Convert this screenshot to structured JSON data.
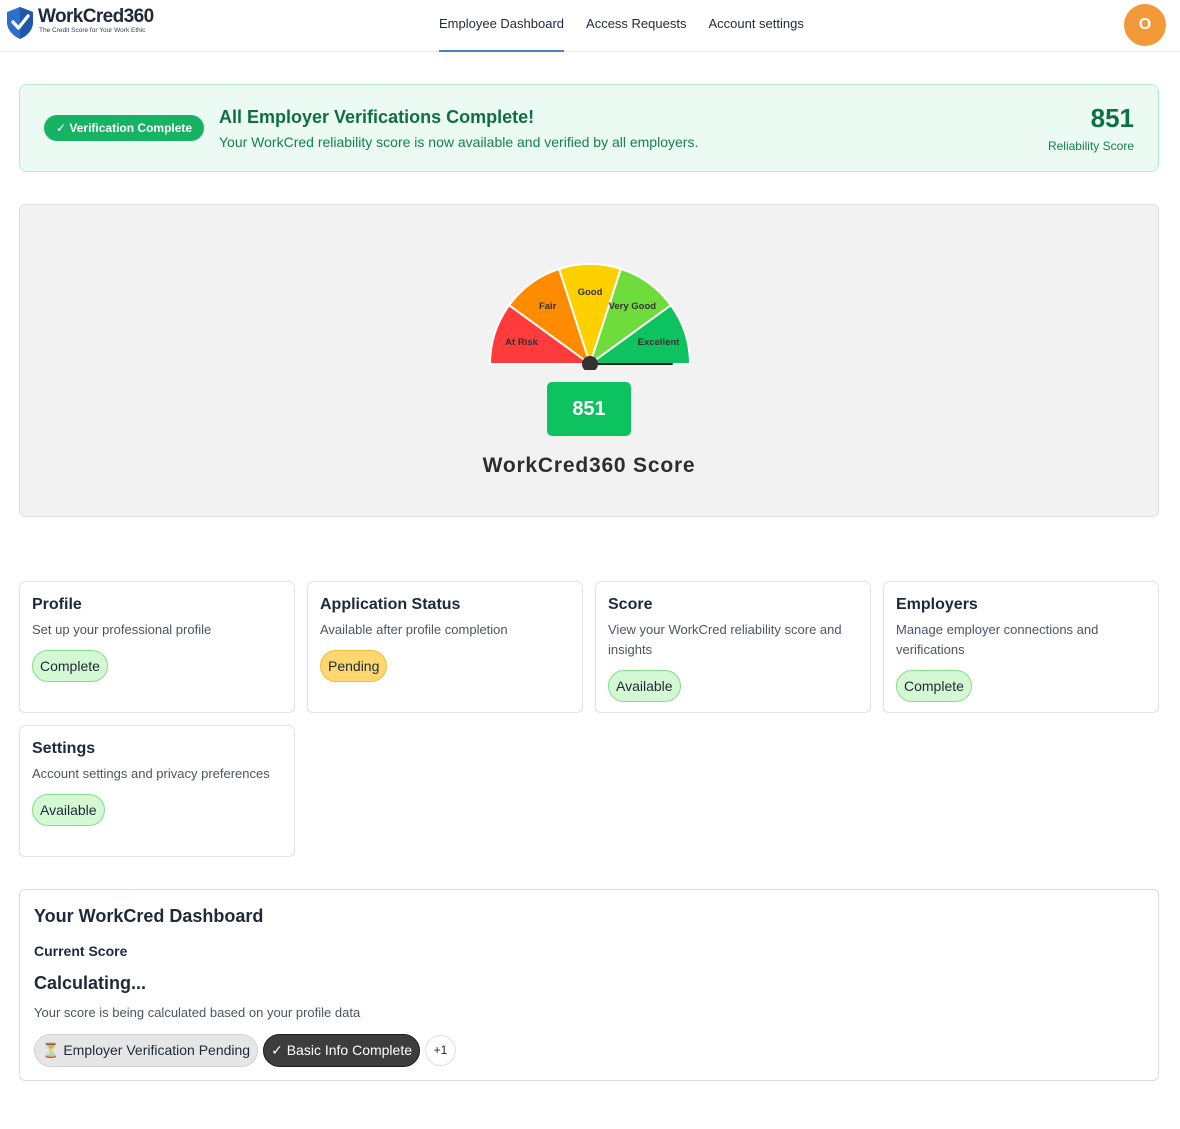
{
  "header": {
    "app_name": "WorkCred360",
    "tagline": "The Credit Score for Your Work Ethic",
    "nav": [
      {
        "label": "Employee Dashboard",
        "active": true
      },
      {
        "label": "Access Requests",
        "active": false
      },
      {
        "label": "Account settings",
        "active": false
      }
    ],
    "avatar_initial": "O"
  },
  "banner": {
    "badge": "✓ Verification Complete",
    "title": "All Employer Verifications Complete!",
    "subtitle": "Your WorkCred reliability score is now available and verified by all employers.",
    "score": "851",
    "score_label": "Reliability Score"
  },
  "gauge": {
    "segments": [
      {
        "label": "At Risk",
        "color": "#ff3b3b"
      },
      {
        "label": "Fair",
        "color": "#ff8c00"
      },
      {
        "label": "Good",
        "color": "#ffd000"
      },
      {
        "label": "Very Good",
        "color": "#6edc3a"
      },
      {
        "label": "Excellent",
        "color": "#0cc35f"
      }
    ],
    "score": "851",
    "score_fraction": 1.0,
    "title": "WorkCred360 Score"
  },
  "cards": [
    {
      "title": "Profile",
      "desc": "Set up your professional profile",
      "status": "Complete",
      "tone": "green"
    },
    {
      "title": "Application Status",
      "desc": "Available after profile completion",
      "status": "Pending",
      "tone": "yellow"
    },
    {
      "title": "Score",
      "desc": "View your WorkCred reliability score and insights",
      "status": "Available",
      "tone": "green"
    },
    {
      "title": "Employers",
      "desc": "Manage employer connections and verifications",
      "status": "Complete",
      "tone": "green"
    },
    {
      "title": "Settings",
      "desc": "Account settings and privacy preferences",
      "status": "Available",
      "tone": "green"
    }
  ],
  "dashboard": {
    "title": "Your WorkCred Dashboard",
    "current_label": "Current Score",
    "current_value": "Calculating...",
    "note": "Your score is being calculated based on your profile data",
    "chips": [
      {
        "label": "⏳ Employer Verification Pending",
        "style": "grey"
      },
      {
        "label": "✓ Basic Info Complete",
        "style": "dark"
      },
      {
        "label": "+1",
        "style": "plus"
      }
    ]
  },
  "colors": {
    "brand_blue": "#2f6fcb",
    "success_green": "#16b364",
    "nav_underline": "#4f7fc1",
    "avatar": "#f29a3a"
  }
}
